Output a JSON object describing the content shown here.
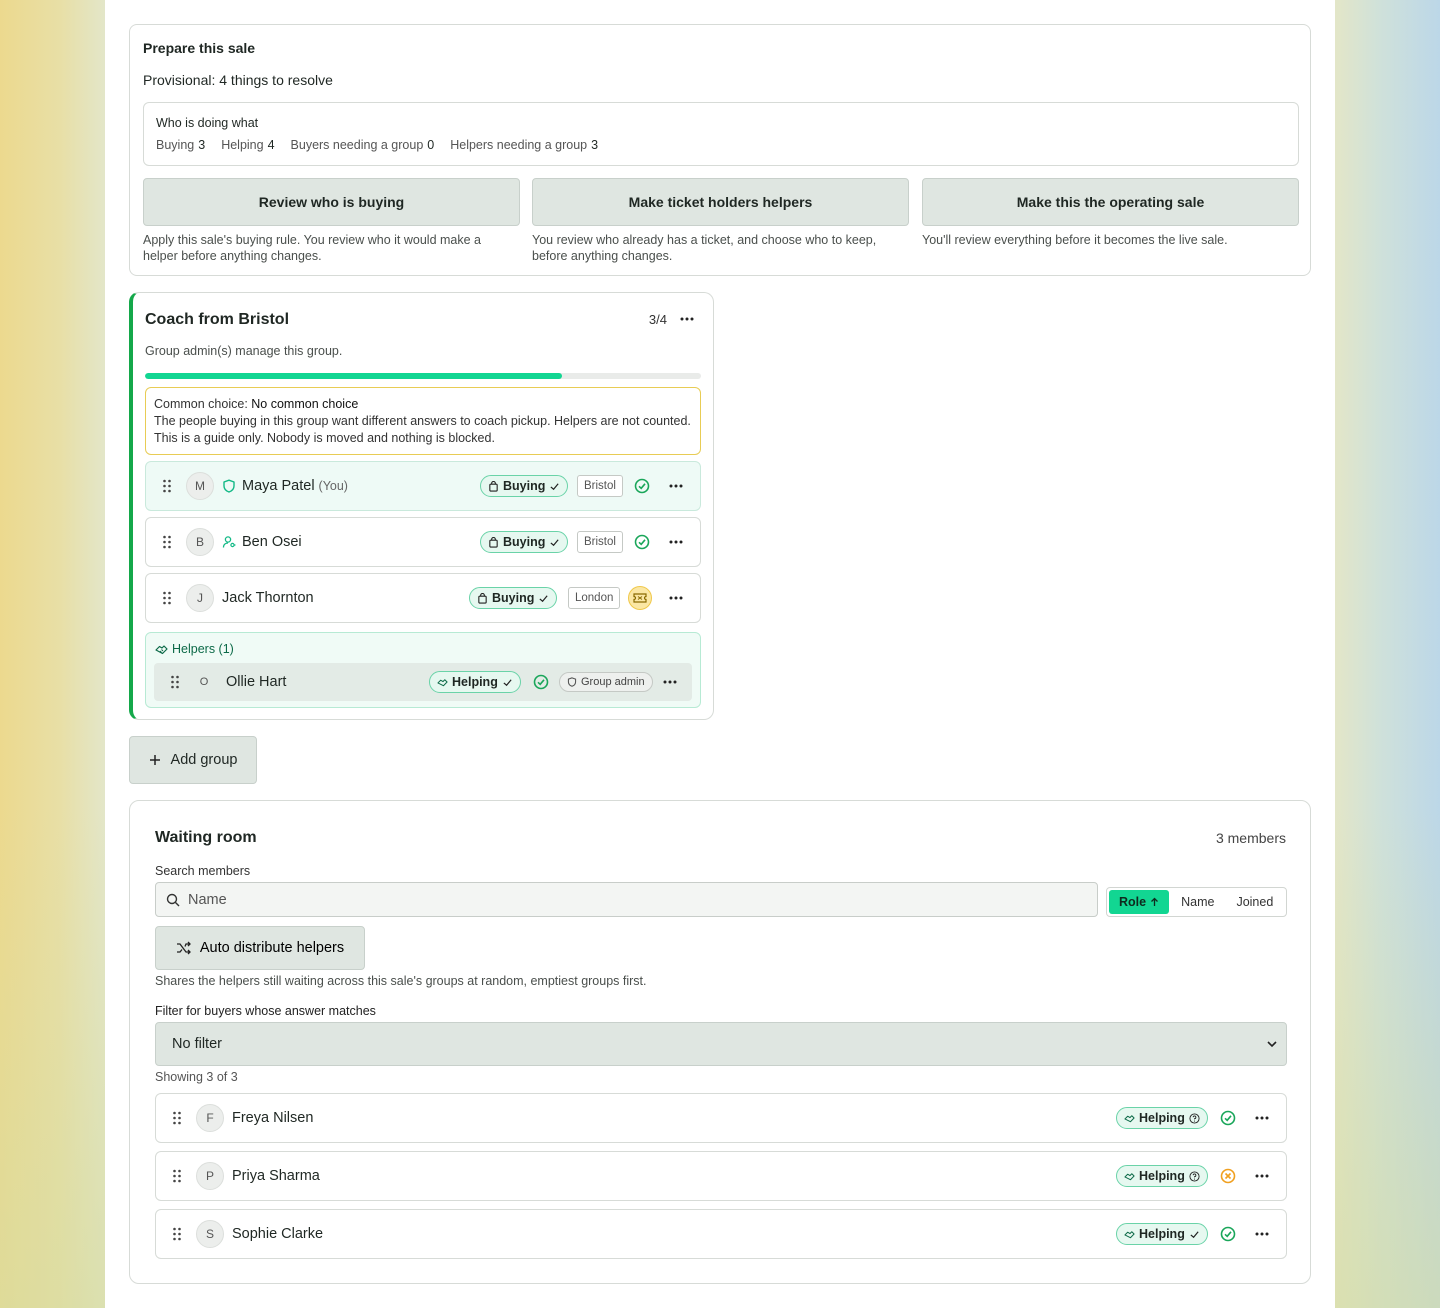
{
  "prepare": {
    "title": "Prepare this sale",
    "status": "Provisional: 4 things to resolve",
    "who": {
      "title": "Who is doing what",
      "stats": [
        {
          "label": "Buying",
          "value": "3"
        },
        {
          "label": "Helping",
          "value": "4"
        },
        {
          "label": "Buyers needing a group",
          "value": "0"
        },
        {
          "label": "Helpers needing a group",
          "value": "3"
        }
      ]
    },
    "actions": [
      {
        "label": "Review who is buying",
        "desc": "Apply this sale's buying rule. You review who it would make a helper before anything changes."
      },
      {
        "label": "Make ticket holders helpers",
        "desc": "You review who already has a ticket, and choose who to keep, before anything changes."
      },
      {
        "label": "Make this the operating sale",
        "desc": "You'll review everything before it becomes the live sale."
      }
    ]
  },
  "group": {
    "title": "Coach from Bristol",
    "count": "3/4",
    "fill_fraction": 0.75,
    "subtitle": "Group admin(s) manage this group.",
    "common_label": "Common choice:",
    "common_value": "No common choice",
    "common_desc": "The people buying in this group want different answers to coach pickup. Helpers are not counted. This is a guide only. Nobody is moved and nothing is blocked.",
    "members": [
      {
        "initial": "M",
        "name": "Maya Patel",
        "you": "(You)",
        "role": "Buying",
        "location": "Bristol",
        "status": "ok",
        "icon": "shield-icon"
      },
      {
        "initial": "B",
        "name": "Ben Osei",
        "role": "Buying",
        "location": "Bristol",
        "status": "ok",
        "icon": "user-key-icon"
      },
      {
        "initial": "J",
        "name": "Jack Thornton",
        "role": "Buying",
        "location": "London",
        "status": "ticket"
      }
    ],
    "helpers_title": "Helpers (1)",
    "helpers": [
      {
        "initial": "O",
        "name": "Ollie Hart",
        "role": "Helping",
        "status": "ok",
        "badge": "Group admin"
      }
    ]
  },
  "add_group_label": "Add group",
  "waiting": {
    "title": "Waiting room",
    "count": "3 members",
    "search_label": "Search members",
    "search_placeholder": "Name",
    "sort": [
      {
        "label": "Role",
        "active": true
      },
      {
        "label": "Name",
        "active": false
      },
      {
        "label": "Joined",
        "active": false
      }
    ],
    "auto_label": "Auto distribute helpers",
    "auto_desc": "Shares the helpers still waiting across this sale's groups at random, emptiest groups first.",
    "filter_label": "Filter for buyers whose answer matches",
    "filter_value": "No filter",
    "showing": "Showing 3 of 3",
    "members": [
      {
        "initial": "F",
        "name": "Freya Nilsen",
        "role": "Helping",
        "status": "ok"
      },
      {
        "initial": "P",
        "name": "Priya Sharma",
        "role": "Helping",
        "status": "warn"
      },
      {
        "initial": "S",
        "name": "Sophie Clarke",
        "role": "Helping",
        "status": "ok"
      }
    ]
  },
  "colors": {
    "accent": "#12d692",
    "group_border": "#14a84a",
    "warning": "#e8cc55",
    "ok": "#1aa65a",
    "warn": "#f0a020"
  }
}
